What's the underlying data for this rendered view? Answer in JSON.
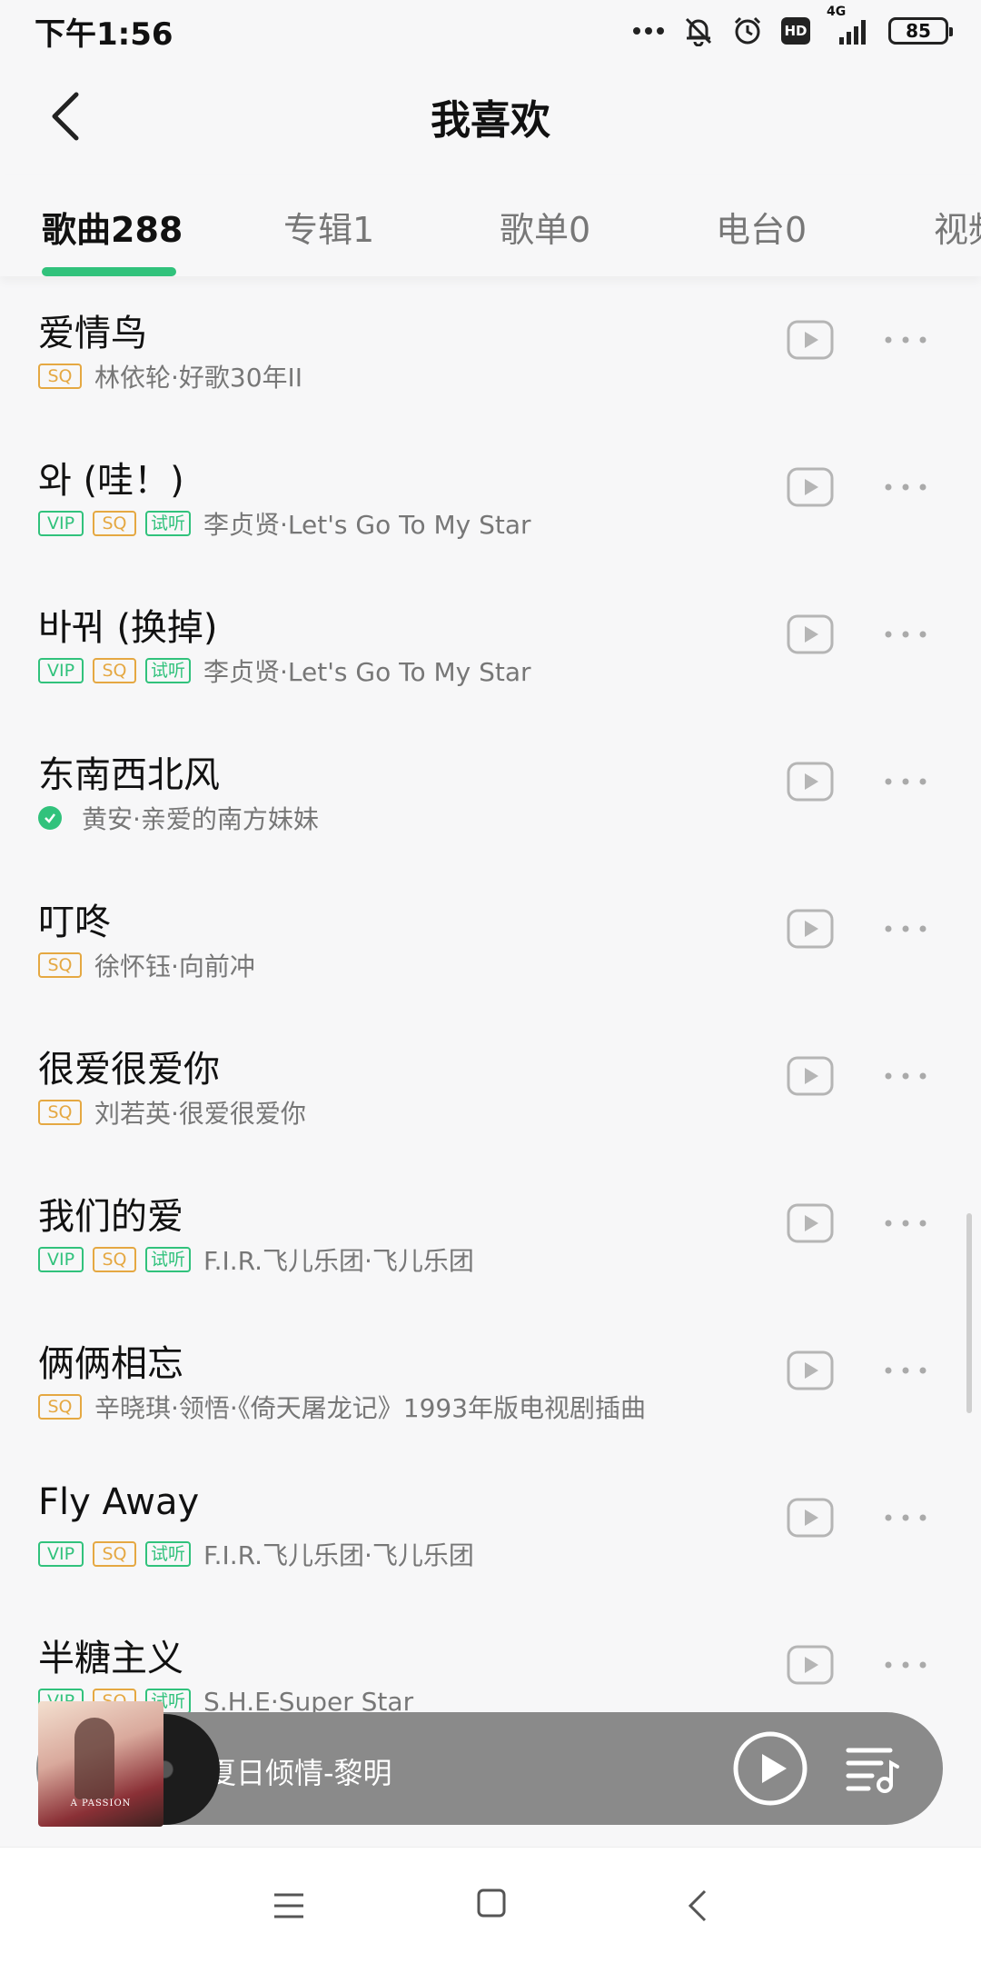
{
  "status_bar": {
    "time": "下午1:56",
    "network": "4G",
    "hd": "HD",
    "battery": "85"
  },
  "header": {
    "title": "我喜欢"
  },
  "tabs": [
    {
      "label": "歌曲288"
    },
    {
      "label": "专辑1"
    },
    {
      "label": "歌单0"
    },
    {
      "label": "电台0"
    },
    {
      "label": "视频"
    }
  ],
  "badges": {
    "vip": "VIP",
    "sq": "SQ",
    "try": "试听"
  },
  "songs": [
    {
      "title": "爱情鸟",
      "artist": "林依轮·好歌30年II",
      "badges": [
        "sq"
      ]
    },
    {
      "title": "와 (哇！)",
      "artist": "李贞贤·Let's Go To My Star",
      "badges": [
        "vip",
        "sq",
        "try"
      ]
    },
    {
      "title": "바꿔 (换掉)",
      "artist": "李贞贤·Let's Go To My Star",
      "badges": [
        "vip",
        "sq",
        "try"
      ]
    },
    {
      "title": "东南西北风",
      "artist": "黄安·亲爱的南方妹妹",
      "badges": [],
      "downloaded": true
    },
    {
      "title": "叮咚",
      "artist": "徐怀钰·向前冲",
      "badges": [
        "sq"
      ]
    },
    {
      "title": "很爱很爱你",
      "artist": "刘若英·很爱很爱你",
      "badges": [
        "sq"
      ]
    },
    {
      "title": "我们的爱",
      "artist": "F.I.R.飞儿乐团·飞儿乐团",
      "badges": [
        "vip",
        "sq",
        "try"
      ]
    },
    {
      "title": "俩俩相忘",
      "artist": "辛晓琪·领悟·《倚天屠龙记》1993年版电视剧插曲",
      "badges": [
        "sq"
      ]
    },
    {
      "title": "Fly Away",
      "artist": "F.I.R.飞儿乐团·飞儿乐团",
      "badges": [
        "vip",
        "sq",
        "try"
      ]
    },
    {
      "title": "半糖主义",
      "artist": "S.H.E·Super Star",
      "badges": [
        "vip",
        "sq",
        "try"
      ]
    }
  ],
  "player": {
    "now_playing": "夏日倾情-黎明",
    "cover_text": "A PASSION"
  },
  "colors": {
    "accent": "#31c27c",
    "sq": "#e5a842",
    "player_bg": "#808080"
  },
  "icons": {
    "back": "chevron-left-icon",
    "mv": "play-video-icon",
    "more": "more-dots-icon",
    "player_play": "play-circle-icon",
    "playlist": "playlist-icon"
  }
}
